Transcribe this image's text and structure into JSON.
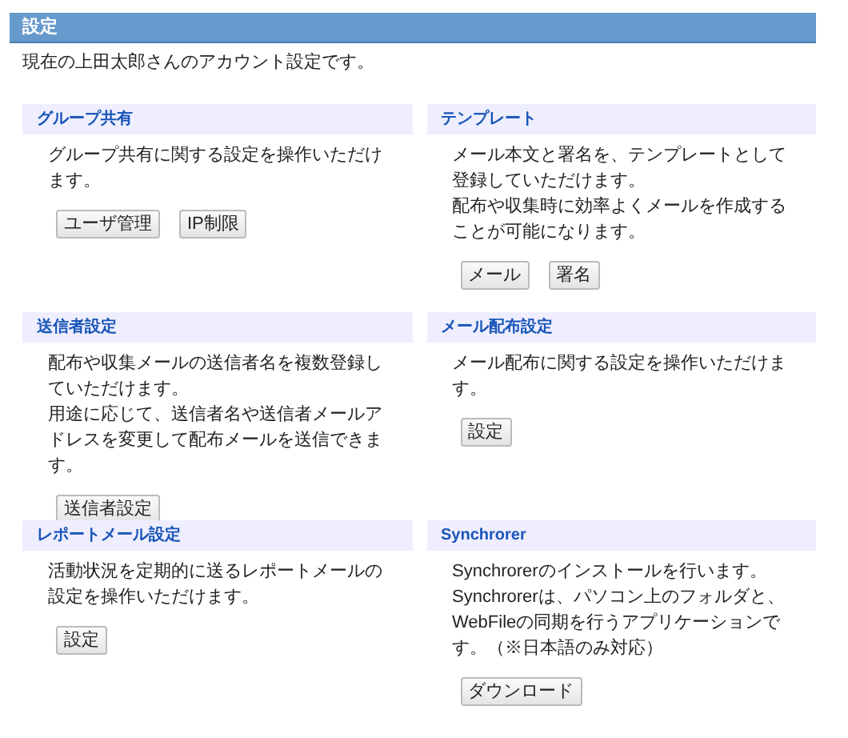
{
  "header": {
    "title": "設定"
  },
  "intro": "現在の上田太郎さんのアカウント設定です。",
  "sections": [
    {
      "title": "グループ共有",
      "paragraphs": [
        "グループ共有に関する設定を操作いただけます。"
      ],
      "buttons": [
        "ユーザ管理",
        "IP制限"
      ]
    },
    {
      "title": "テンプレート",
      "paragraphs": [
        "メール本文と署名を、テンプレートとして登録していただけます。",
        "配布や収集時に効率よくメールを作成することが可能になります。"
      ],
      "buttons": [
        "メール",
        "署名"
      ]
    },
    {
      "title": "送信者設定",
      "paragraphs": [
        "配布や収集メールの送信者名を複数登録していただけます。",
        "用途に応じて、送信者名や送信者メールアドレスを変更して配布メールを送信できます。"
      ],
      "buttons": [
        "送信者設定"
      ]
    },
    {
      "title": "メール配布設定",
      "paragraphs": [
        "メール配布に関する設定を操作いただけます。"
      ],
      "buttons": [
        "設定"
      ]
    },
    {
      "title": "レポートメール設定",
      "paragraphs": [
        "活動状況を定期的に送るレポートメールの設定を操作いただけます。"
      ],
      "buttons": [
        "設定"
      ]
    },
    {
      "title": "Synchrorer",
      "paragraphs": [
        "Synchrorerのインストールを行います。",
        "Synchrorerは、パソコン上のフォルダと、WebFileの同期を行うアプリケーションです。（※日本語のみ対応）"
      ],
      "buttons": [
        "ダウンロード"
      ]
    }
  ]
}
